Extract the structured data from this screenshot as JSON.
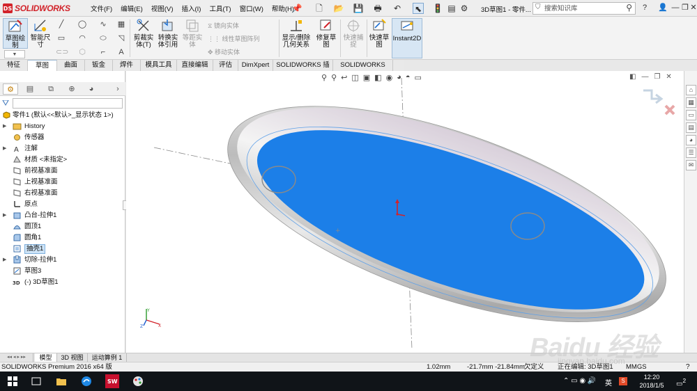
{
  "app": {
    "brand": "SOLIDWORKS",
    "doc_title": "3D草图1 - 零件..."
  },
  "menu": [
    "文件(F)",
    "编辑(E)",
    "视图(V)",
    "插入(I)",
    "工具(T)",
    "窗口(W)",
    "帮助(H)"
  ],
  "search": {
    "placeholder": "搜索知识库"
  },
  "commands": {
    "sketch": "草图绘制",
    "smart_dim": "智能尺寸",
    "trim": "剪裁实体(T)",
    "convert": "转换实体引用",
    "offset": "等距实体",
    "mirror": "镜向实体",
    "linear_pattern": "线性草图阵列",
    "move": "移动实体",
    "relations": "显示/删除几何关系",
    "repair": "修复草图",
    "quick_snap": "快速捕捉",
    "rapid_sketch": "快速草图",
    "instant2d": "Instant2D"
  },
  "tabs": [
    "特征",
    "草图",
    "曲面",
    "钣金",
    "焊件",
    "模具工具",
    "直接编辑",
    "评估",
    "DimXpert",
    "SOLIDWORKS 插件",
    "SOLIDWORKS MBD"
  ],
  "tree": {
    "root": "零件1  (默认<<默认>_显示状态 1>)",
    "items": [
      "History",
      "传感器",
      "注解",
      "材质 <未指定>",
      "前视基准面",
      "上视基准面",
      "右视基准面",
      "原点",
      "凸台-拉伸1",
      "圆顶1",
      "圆角1",
      "抽壳1",
      "切除-拉伸1",
      "草图3",
      "(-) 3D草图1"
    ]
  },
  "bottom_tabs": [
    "模型",
    "3D 视图",
    "运动算例 1"
  ],
  "status": {
    "product": "SOLIDWORKS Premium 2016 x64 版",
    "radius": "1.02mm",
    "coords": "-21.7mm  -21.84mm",
    "state": "欠定义",
    "editing": "正在编辑: 3D草图1",
    "units": "MMGS"
  },
  "taskbar": {
    "time": "12:20",
    "date": "2018/1/5",
    "ime": "英",
    "notif_count": "2"
  },
  "watermark": {
    "brand": "Baidu 经验",
    "url": "jingyan.baidu.com"
  },
  "colors": {
    "accent_red": "#d2232a",
    "shell_blue": "#1c7fe8",
    "selection": "#cde3f6"
  }
}
